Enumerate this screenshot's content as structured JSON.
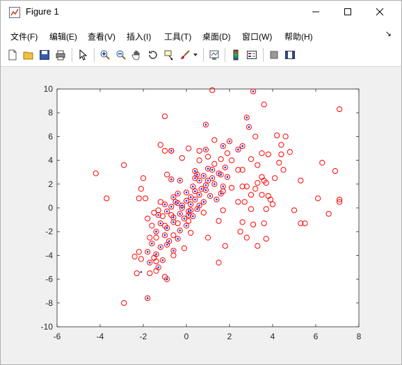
{
  "window": {
    "title": "Figure 1",
    "minimize_label": "–",
    "maximize_label": "□",
    "close_label": "✕"
  },
  "menu": {
    "items": [
      {
        "label": "文件(F)"
      },
      {
        "label": "编辑(E)"
      },
      {
        "label": "查看(V)"
      },
      {
        "label": "插入(I)"
      },
      {
        "label": "工具(T)"
      },
      {
        "label": "桌面(D)"
      },
      {
        "label": "窗口(W)"
      },
      {
        "label": "帮助(H)"
      }
    ],
    "dock_glyph": "↘"
  },
  "toolbar": {
    "buttons": [
      "new-figure-icon",
      "open-file-icon",
      "save-icon",
      "print-icon",
      "pointer-icon",
      "zoom-in-icon",
      "zoom-out-icon",
      "pan-icon",
      "rotate-3d-icon",
      "data-cursor-icon",
      "brush-icon",
      "link-plot-icon",
      "colorbar-icon",
      "legend-icon",
      "hide-plot-tools-icon",
      "show-plot-tools-icon"
    ]
  },
  "chart_data": {
    "type": "scatter",
    "title": "",
    "xlabel": "",
    "ylabel": "",
    "xlim": [
      -6,
      8
    ],
    "ylim": [
      -10,
      10
    ],
    "xticks": [
      -6,
      -4,
      -2,
      0,
      2,
      4,
      6,
      8
    ],
    "yticks": [
      -10,
      -8,
      -6,
      -4,
      -2,
      0,
      2,
      4,
      6,
      8,
      10
    ],
    "grid": false,
    "legend": "none",
    "series": [
      {
        "marker": "circle",
        "color": "#ff0000",
        "points": [
          [
            1.2,
            9.9
          ],
          [
            3.1,
            9.8
          ],
          [
            2.8,
            7.6
          ],
          [
            3.6,
            8.7
          ],
          [
            7.1,
            8.3
          ],
          [
            -1.0,
            7.7
          ],
          [
            2.9,
            6.8
          ],
          [
            3.2,
            6.0
          ],
          [
            4.2,
            6.1
          ],
          [
            4.6,
            6.0
          ],
          [
            4.4,
            5.3
          ],
          [
            -1.2,
            5.3
          ],
          [
            -0.7,
            4.8
          ],
          [
            -1.0,
            4.8
          ],
          [
            0.1,
            5.0
          ],
          [
            0.6,
            4.8
          ],
          [
            0.9,
            4.9
          ],
          [
            2.4,
            4.9
          ],
          [
            3.5,
            4.6
          ],
          [
            3.8,
            4.5
          ],
          [
            4.4,
            4.5
          ],
          [
            4.8,
            4.7
          ],
          [
            -0.2,
            4.2
          ],
          [
            1.6,
            4.1
          ],
          [
            2.1,
            4.0
          ],
          [
            3.0,
            4.1
          ],
          [
            3.3,
            3.6
          ],
          [
            4.3,
            3.8
          ],
          [
            4.5,
            3.2
          ],
          [
            6.3,
            3.8
          ],
          [
            6.9,
            3.1
          ],
          [
            -4.2,
            2.9
          ],
          [
            -2.9,
            3.6
          ],
          [
            -0.9,
            2.8
          ],
          [
            2.4,
            3.2
          ],
          [
            2.6,
            3.2
          ],
          [
            3.5,
            2.6
          ],
          [
            3.6,
            2.3
          ],
          [
            4.1,
            2.5
          ],
          [
            5.3,
            2.3
          ],
          [
            3.3,
            2.1
          ],
          [
            3.7,
            2.1
          ],
          [
            2.1,
            1.7
          ],
          [
            2.6,
            1.8
          ],
          [
            2.8,
            1.8
          ],
          [
            3.2,
            1.6
          ],
          [
            -2.0,
            2.5
          ],
          [
            -2.1,
            1.6
          ],
          [
            -1.9,
            0.8
          ],
          [
            -2.2,
            0.8
          ],
          [
            -3.7,
            0.8
          ],
          [
            -1.2,
            0.5
          ],
          [
            1.7,
            1.4
          ],
          [
            3.0,
            1.1
          ],
          [
            3.5,
            1.1
          ],
          [
            3.8,
            1.0
          ],
          [
            2.4,
            0.5
          ],
          [
            2.7,
            0.5
          ],
          [
            3.9,
            0.7
          ],
          [
            6.1,
            0.8
          ],
          [
            7.1,
            0.7
          ],
          [
            7.1,
            0.5
          ],
          [
            -1.3,
            -0.2
          ],
          [
            -1.5,
            -0.4
          ],
          [
            -1.8,
            -0.9
          ],
          [
            -1.1,
            -0.7
          ],
          [
            -0.7,
            -0.6
          ],
          [
            0.8,
            -0.4
          ],
          [
            1.7,
            -0.2
          ],
          [
            3.0,
            -0.1
          ],
          [
            3.7,
            -0.1
          ],
          [
            4.0,
            0.3
          ],
          [
            5.0,
            -0.2
          ],
          [
            6.6,
            -0.5
          ],
          [
            -1.6,
            -1.5
          ],
          [
            -1.0,
            -1.5
          ],
          [
            -0.4,
            -1.3
          ],
          [
            0.1,
            -1.1
          ],
          [
            1.5,
            -1.1
          ],
          [
            2.6,
            -1.2
          ],
          [
            3.1,
            -1.4
          ],
          [
            3.6,
            -1.3
          ],
          [
            5.3,
            -1.3
          ],
          [
            5.5,
            -1.3
          ],
          [
            -1.7,
            -2.5
          ],
          [
            -1.4,
            -2.5
          ],
          [
            -0.6,
            -2.3
          ],
          [
            0.2,
            -2.1
          ],
          [
            2.5,
            -2.0
          ],
          [
            1.0,
            -2.5
          ],
          [
            2.8,
            -2.5
          ],
          [
            3.7,
            -2.6
          ],
          [
            3.3,
            -3.2
          ],
          [
            -0.1,
            -3.4
          ],
          [
            1.8,
            -3.2
          ],
          [
            -2.2,
            -3.7
          ],
          [
            -2.4,
            -4.1
          ],
          [
            -2.1,
            -4.3
          ],
          [
            -1.5,
            -4.2
          ],
          [
            -1.4,
            -4.5
          ],
          [
            -0.6,
            -4.0
          ],
          [
            1.5,
            -4.6
          ],
          [
            -2.3,
            -5.5
          ],
          [
            -1.7,
            -5.5
          ],
          [
            -1.4,
            -5.3
          ],
          [
            -1.0,
            -5.8
          ],
          [
            -2.9,
            -8.0
          ],
          [
            -1.8,
            -7.6
          ],
          [
            -0.9,
            -6.0
          ],
          [
            0.9,
            7.0
          ],
          [
            2.6,
            5.2
          ],
          [
            2.0,
            5.6
          ],
          [
            1.3,
            5.7
          ],
          [
            1.7,
            5.2
          ],
          [
            -0.7,
            4.8
          ],
          [
            0.5,
            2.8
          ],
          [
            1.0,
            3.3
          ],
          [
            1.5,
            2.9
          ],
          [
            1.8,
            3.4
          ],
          [
            -0.3,
            2.3
          ],
          [
            -0.7,
            2.4
          ],
          [
            0.4,
            2.5
          ],
          [
            0.8,
            2.7
          ],
          [
            1.2,
            3.2
          ],
          [
            1.6,
            2.8
          ],
          [
            1.9,
            2.6
          ],
          [
            0.3,
            1.8
          ],
          [
            0.6,
            2.3
          ],
          [
            0.9,
            1.9
          ],
          [
            1.3,
            2.0
          ],
          [
            1.7,
            1.8
          ],
          [
            -0.6,
            0.9
          ],
          [
            -0.4,
            1.2
          ],
          [
            0.0,
            1.3
          ],
          [
            0.2,
            0.9
          ],
          [
            0.4,
            1.4
          ],
          [
            0.6,
            1.1
          ],
          [
            0.9,
            1.5
          ],
          [
            1.1,
            1.0
          ],
          [
            1.4,
            0.7
          ],
          [
            1.6,
            1.2
          ],
          [
            -1.0,
            0.3
          ],
          [
            -0.7,
            0.1
          ],
          [
            -0.4,
            0.4
          ],
          [
            -0.2,
            0.0
          ],
          [
            0.0,
            0.6
          ],
          [
            0.2,
            0.3
          ],
          [
            0.4,
            0.7
          ],
          [
            0.6,
            0.2
          ],
          [
            0.8,
            0.5
          ],
          [
            -1.3,
            -0.6
          ],
          [
            -0.9,
            -0.3
          ],
          [
            -0.6,
            -0.8
          ],
          [
            -0.3,
            -0.5
          ],
          [
            -0.1,
            -0.9
          ],
          [
            0.1,
            -0.3
          ],
          [
            0.3,
            -0.7
          ],
          [
            0.5,
            -0.1
          ],
          [
            -1.2,
            -1.3
          ],
          [
            -0.9,
            -1.7
          ],
          [
            -0.6,
            -1.2
          ],
          [
            -0.3,
            -1.9
          ],
          [
            0.0,
            -1.5
          ],
          [
            -1.4,
            -2.0
          ],
          [
            -1.0,
            -2.3
          ],
          [
            -0.8,
            -2.8
          ],
          [
            -0.4,
            -2.6
          ],
          [
            -1.6,
            -3.0
          ],
          [
            -1.2,
            -3.3
          ],
          [
            -0.9,
            -3.1
          ],
          [
            -0.6,
            -3.6
          ],
          [
            -1.8,
            -3.7
          ],
          [
            -1.4,
            -3.9
          ],
          [
            -1.1,
            -4.4
          ],
          [
            -1.7,
            -4.6
          ],
          [
            -1.3,
            -5.0
          ],
          [
            0.2,
            -0.2
          ],
          [
            -0.2,
            0.2
          ],
          [
            0.1,
            -0.6
          ],
          [
            -0.5,
            0.5
          ],
          [
            1.0,
            2.3
          ],
          [
            0.7,
            1.6
          ],
          [
            1.2,
            2.5
          ],
          [
            0.4,
            3.1
          ],
          [
            1.9,
            4.6
          ],
          [
            1.0,
            4.3
          ],
          [
            0.6,
            4.0
          ],
          [
            1.3,
            3.7
          ]
        ]
      },
      {
        "marker": "dot",
        "color": "#1e3cff",
        "points": [
          [
            0.9,
            7.0
          ],
          [
            2.6,
            5.2
          ],
          [
            2.0,
            5.6
          ],
          [
            1.7,
            5.2
          ],
          [
            0.9,
            4.9
          ],
          [
            2.4,
            4.9
          ],
          [
            -0.7,
            4.8
          ],
          [
            0.5,
            2.8
          ],
          [
            1.0,
            3.3
          ],
          [
            1.5,
            2.9
          ],
          [
            1.8,
            3.4
          ],
          [
            -0.3,
            2.3
          ],
          [
            -0.7,
            2.4
          ],
          [
            0.4,
            2.5
          ],
          [
            0.8,
            2.7
          ],
          [
            1.2,
            3.2
          ],
          [
            1.6,
            2.8
          ],
          [
            1.9,
            2.6
          ],
          [
            0.3,
            1.8
          ],
          [
            0.6,
            2.3
          ],
          [
            0.9,
            1.9
          ],
          [
            1.3,
            2.0
          ],
          [
            1.7,
            1.8
          ],
          [
            -0.6,
            0.9
          ],
          [
            -0.4,
            1.2
          ],
          [
            0.0,
            1.3
          ],
          [
            0.2,
            0.9
          ],
          [
            0.4,
            1.4
          ],
          [
            0.6,
            1.1
          ],
          [
            0.9,
            1.5
          ],
          [
            1.1,
            1.0
          ],
          [
            1.4,
            0.7
          ],
          [
            1.6,
            1.2
          ],
          [
            -1.0,
            0.3
          ],
          [
            -0.7,
            0.1
          ],
          [
            -0.4,
            0.4
          ],
          [
            -0.2,
            0.0
          ],
          [
            0.0,
            0.6
          ],
          [
            0.2,
            0.3
          ],
          [
            0.4,
            0.7
          ],
          [
            0.6,
            0.2
          ],
          [
            0.8,
            0.5
          ],
          [
            -1.3,
            -0.6
          ],
          [
            -0.9,
            -0.3
          ],
          [
            -0.6,
            -0.8
          ],
          [
            -0.3,
            -0.5
          ],
          [
            -0.1,
            -0.9
          ],
          [
            0.1,
            -0.3
          ],
          [
            0.3,
            -0.7
          ],
          [
            0.5,
            -0.1
          ],
          [
            -1.2,
            -1.3
          ],
          [
            -0.9,
            -1.7
          ],
          [
            -0.6,
            -1.2
          ],
          [
            -0.3,
            -1.9
          ],
          [
            0.0,
            -1.5
          ],
          [
            -1.4,
            -2.0
          ],
          [
            -1.0,
            -2.3
          ],
          [
            -0.8,
            -2.8
          ],
          [
            -0.4,
            -2.6
          ],
          [
            -1.6,
            -3.0
          ],
          [
            -1.2,
            -3.3
          ],
          [
            -0.9,
            -3.1
          ],
          [
            -0.6,
            -3.6
          ],
          [
            -1.8,
            -3.7
          ],
          [
            -1.4,
            -3.9
          ],
          [
            -1.1,
            -4.4
          ],
          [
            -1.7,
            -4.6
          ],
          [
            -1.3,
            -5.0
          ],
          [
            -2.1,
            -5.4
          ],
          [
            -1.8,
            -7.6
          ],
          [
            -0.9,
            -6.0
          ],
          [
            2.8,
            7.6
          ],
          [
            2.9,
            6.8
          ],
          [
            3.1,
            9.8
          ],
          [
            0.2,
            -0.2
          ],
          [
            -0.2,
            0.2
          ],
          [
            0.1,
            -0.6
          ],
          [
            -0.5,
            0.5
          ],
          [
            1.0,
            2.3
          ],
          [
            0.7,
            1.6
          ],
          [
            1.2,
            2.5
          ],
          [
            0.4,
            3.1
          ]
        ]
      }
    ]
  }
}
